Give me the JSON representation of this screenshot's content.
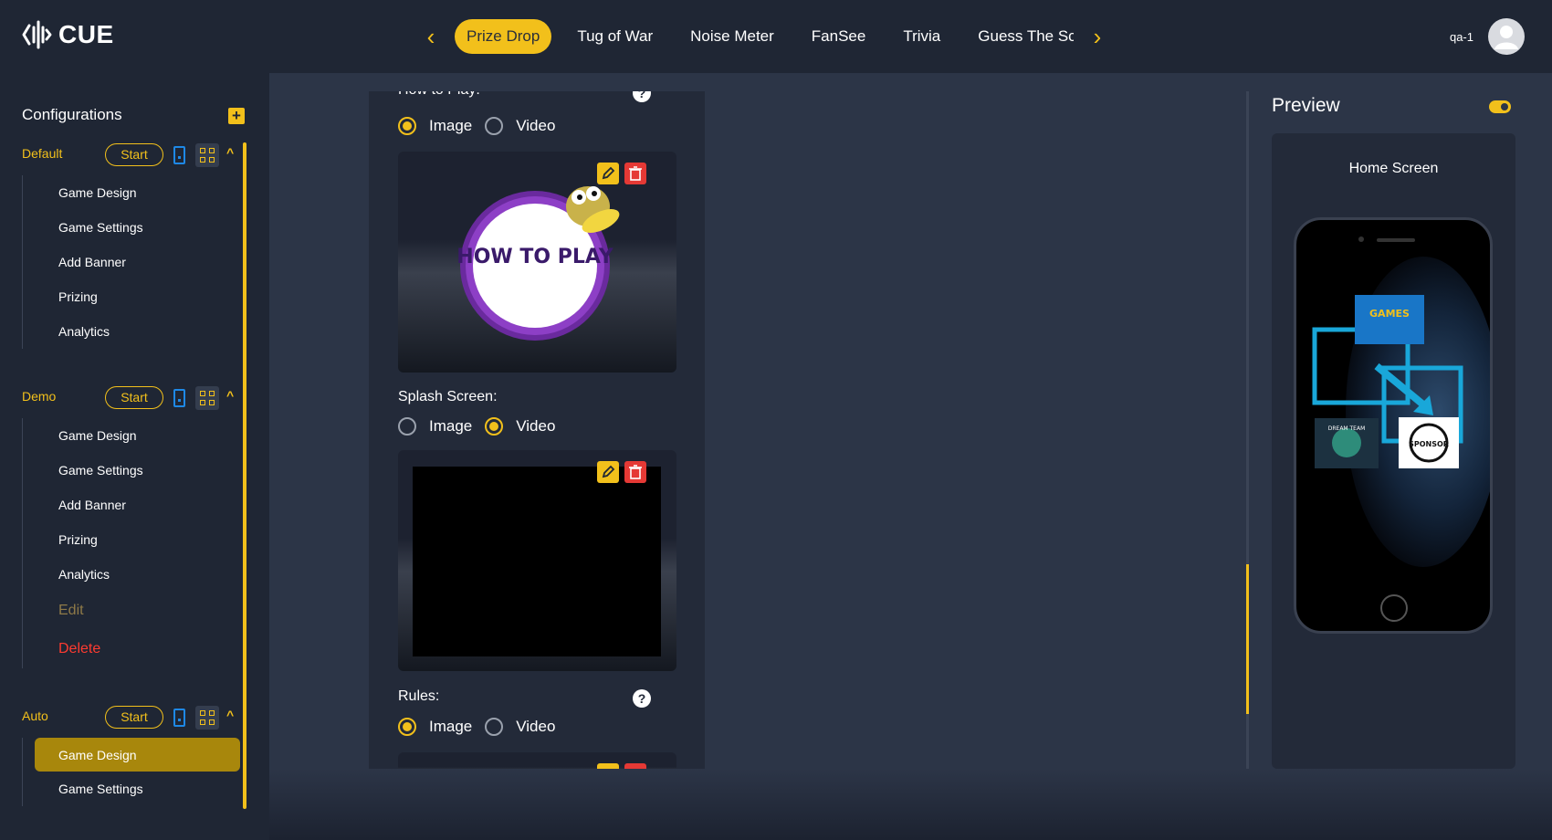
{
  "app": {
    "logo_text": "CUE"
  },
  "tabs": [
    {
      "label": "Prize Drop",
      "active": true
    },
    {
      "label": "Tug of War"
    },
    {
      "label": "Noise Meter"
    },
    {
      "label": "FanSee"
    },
    {
      "label": "Trivia"
    },
    {
      "label": "Guess The Score"
    }
  ],
  "user": {
    "name": "qa-1"
  },
  "sidebar": {
    "title": "Configurations",
    "start_label": "Start",
    "groups": [
      {
        "name": "Default",
        "items": [
          "Game Design",
          "Game Settings",
          "Add Banner",
          "Prizing",
          "Analytics"
        ]
      },
      {
        "name": "Demo",
        "items": [
          "Game Design",
          "Game Settings",
          "Add Banner",
          "Prizing",
          "Analytics"
        ],
        "edit_label": "Edit",
        "delete_label": "Delete"
      },
      {
        "name": "Auto",
        "items": [
          "Game Design",
          "Game Settings"
        ],
        "active_item": "Game Design"
      }
    ]
  },
  "form": {
    "how_to_play_label": "How to Play:",
    "how_to_play_image_text": "HOW TO PLAY",
    "splash_label": "Splash Screen:",
    "rules_label": "Rules:",
    "image_option": "Image",
    "video_option": "Video",
    "help_symbol": "?",
    "how_to_play_media": "Image",
    "splash_media": "Video",
    "rules_media": "Image"
  },
  "preview": {
    "title": "Preview",
    "screen_label": "Home Screen",
    "enabled": true,
    "banner_games": "GAMES",
    "banner_dream": "DREAM TEAM",
    "banner_sponsor": "SPONSOR"
  },
  "colors": {
    "accent": "#f2c01b",
    "danger": "#e53935",
    "background": "#1f2634",
    "panel": "#2c3547"
  }
}
